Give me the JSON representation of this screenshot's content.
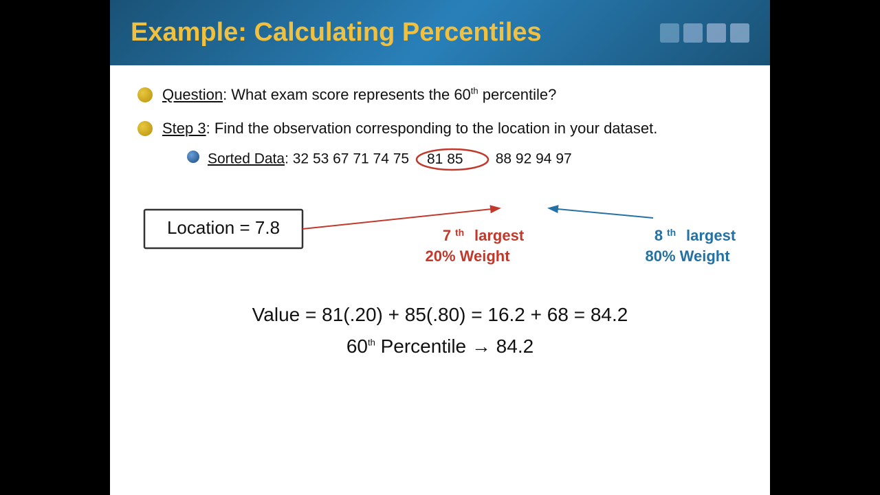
{
  "header": {
    "title": "Example: Calculating Percentiles",
    "squares": [
      {
        "color": "#6699bb"
      },
      {
        "color": "#8ab0cc"
      },
      {
        "color": "#aaccdd"
      },
      {
        "color": "#c8ddee"
      }
    ]
  },
  "bullet1": {
    "label": "Question",
    "text": ": What exam score represents the 60",
    "sup": "th",
    "text2": " percentile?"
  },
  "bullet2": {
    "label": "Step 3",
    "text": ": Find the observation corresponding to the location in your dataset."
  },
  "subBullet": {
    "label": "Sorted Data",
    "text": ": 32  53  67  71  74  75  81  85  88  92  94  97"
  },
  "locationBox": "Location = 7.8",
  "annotation7th": {
    "line1": "7th largest",
    "line2": "20% Weight"
  },
  "annotation8th": {
    "line1": "8th largest",
    "line2": "80% Weight"
  },
  "formula": "Value = 81(.20) + 85(.80) = 16.2 + 68 = 84.2",
  "percentile": {
    "text": "60",
    "sup": "th",
    "text2": " Percentile → 84.2"
  }
}
